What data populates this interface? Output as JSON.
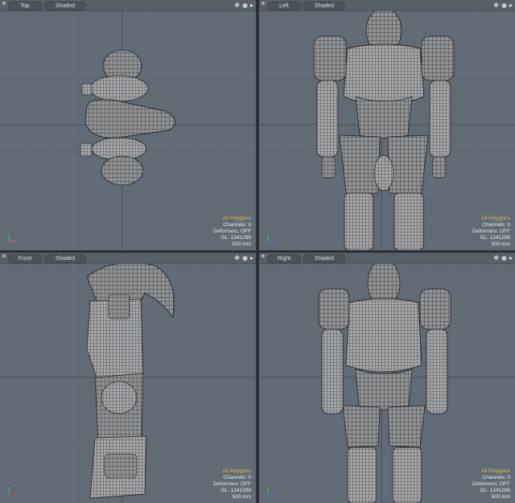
{
  "viewports": [
    {
      "id": "top",
      "label": "Top",
      "shading": "Shaded",
      "info": {
        "selection": "All Polygons",
        "channels": "Channels: 0",
        "deformers": "Deformers: OFF",
        "gl": "GL: 1341288",
        "scale": "500 mm"
      }
    },
    {
      "id": "left",
      "label": "Left",
      "shading": "Shaded",
      "info": {
        "selection": "All Polygons",
        "channels": "Channels: 0",
        "deformers": "Deformers: OFF",
        "gl": "GL: 1341288",
        "scale": "500 mm"
      }
    },
    {
      "id": "front",
      "label": "Front",
      "shading": "Shaded",
      "info": {
        "selection": "All Polygons",
        "channels": "Channels: 0",
        "deformers": "Deformers: OFF",
        "gl": "GL: 1341288",
        "scale": "500 mm"
      }
    },
    {
      "id": "right",
      "label": "Right",
      "shading": "Shaded",
      "info": {
        "selection": "All Polygons",
        "channels": "Channels: 0",
        "deformers": "Deformers: OFF",
        "gl": "GL: 1341288",
        "scale": "500 mm"
      }
    }
  ],
  "colors": {
    "viewport_bg": "#606b76",
    "header_bg": "#575f67",
    "highlight": "#f0b53a",
    "model": "#9ea0a2",
    "wire": "#2b2b2b"
  },
  "icons": {
    "move": "move-icon",
    "zoom": "zoom-icon",
    "rotate": "rotate-icon",
    "expand": "expand-icon"
  }
}
